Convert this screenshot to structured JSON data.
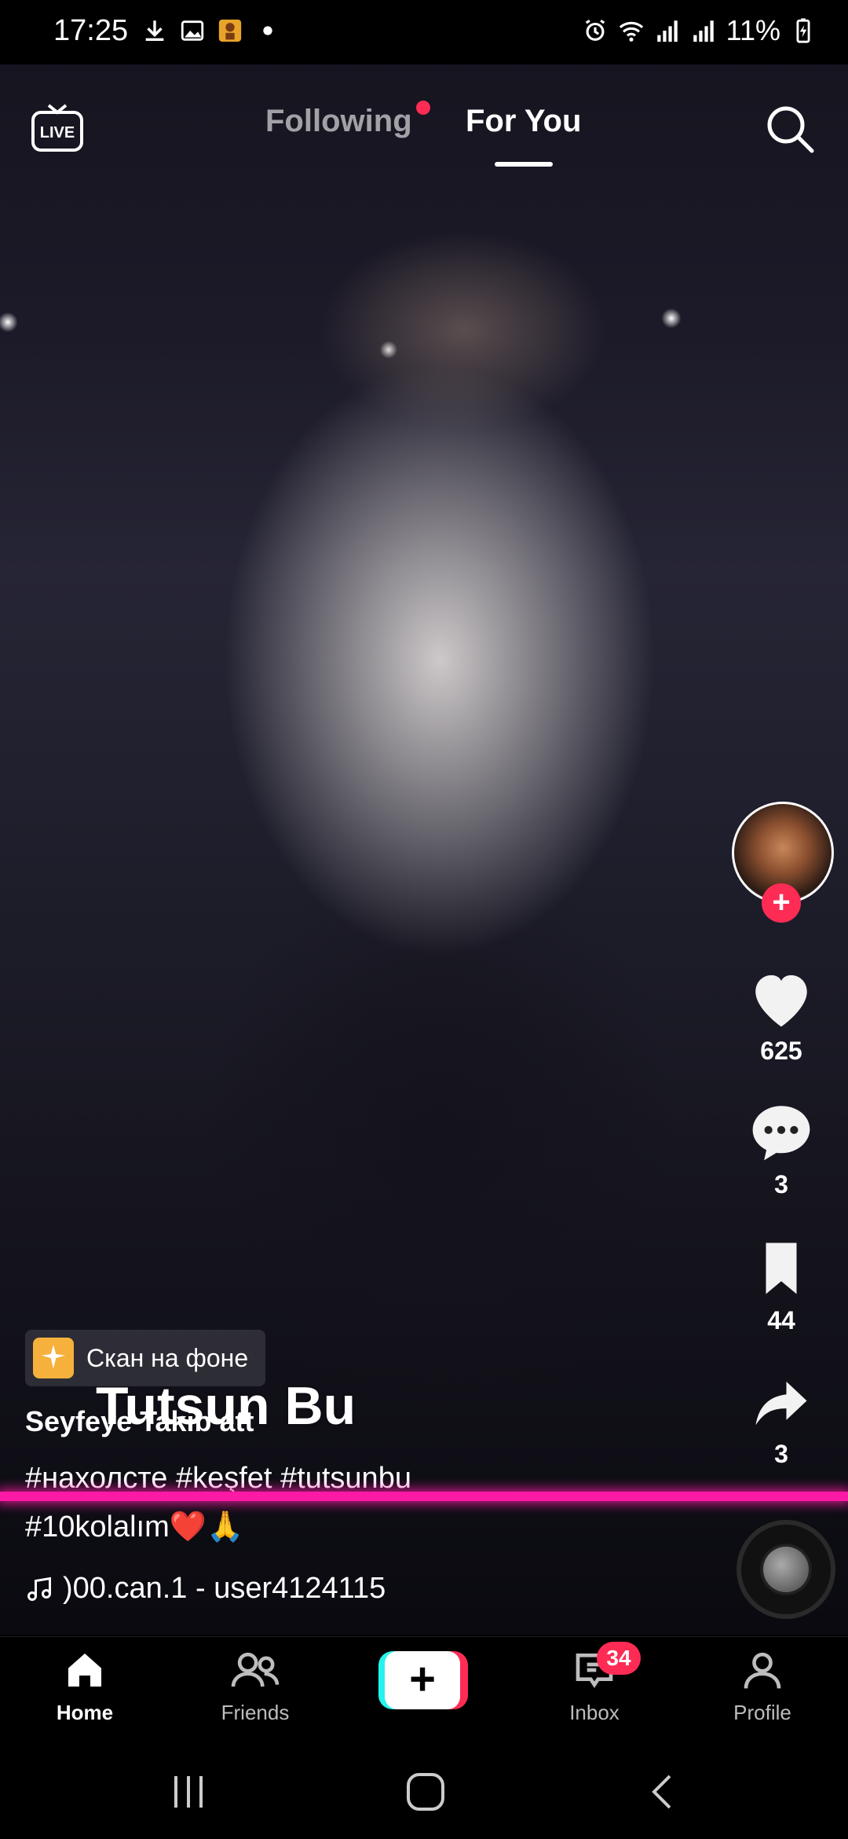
{
  "status_bar": {
    "time": "17:25",
    "battery": "11%"
  },
  "top_nav": {
    "following_label": "Following",
    "for_you_label": "For You",
    "active_tab": "For You"
  },
  "video": {
    "overlay_caption": "Tutsun Bu"
  },
  "right_rail": {
    "likes": "625",
    "comments": "3",
    "bookmarks": "44",
    "shares": "3"
  },
  "effect_chip": {
    "label": "Скан на фоне"
  },
  "post": {
    "username": "Seyfeye Takib att",
    "hashtags_line1": "#нахолсте #keşfet #tutsunbu",
    "hashtags_line2": "#10kolalım❤️🙏",
    "music": ")00.can.1 - user4124115"
  },
  "bottom_nav": {
    "home_label": "Home",
    "friends_label": "Friends",
    "inbox_label": "Inbox",
    "inbox_badge": "34",
    "profile_label": "Profile"
  },
  "colors": {
    "accent": "#fe2c55",
    "cyan": "#25f4ee",
    "progress_glow": "#ff1aa6"
  }
}
